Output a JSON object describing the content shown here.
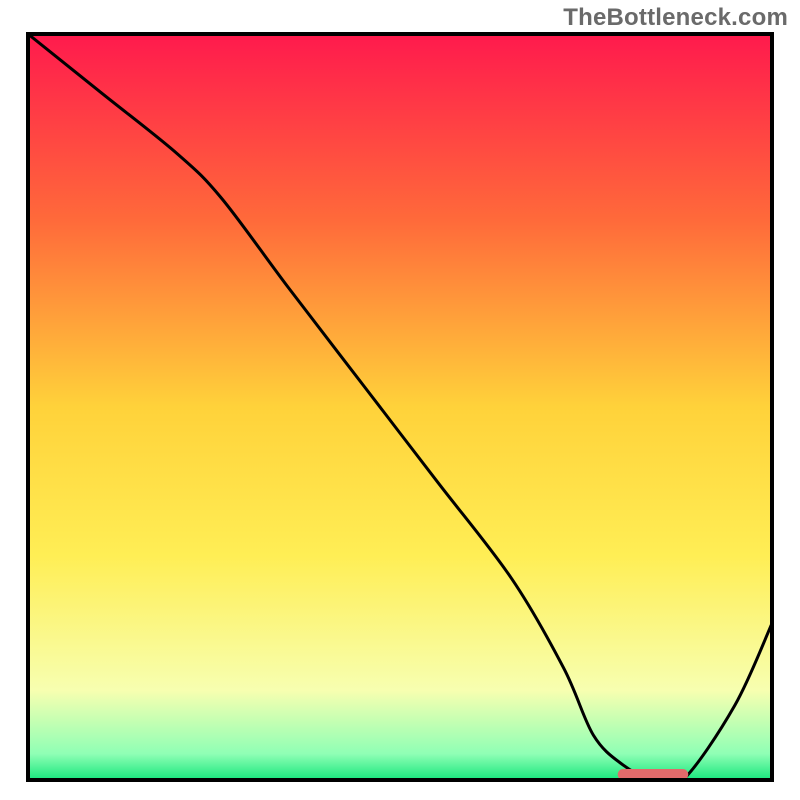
{
  "watermark": "TheBottleneck.com",
  "chart_data": {
    "type": "line",
    "title": "",
    "xlabel": "",
    "ylabel": "",
    "xlim": [
      0,
      100
    ],
    "ylim": [
      0,
      100
    ],
    "grid": false,
    "legend": false,
    "background_gradient": {
      "direction": "vertical",
      "stops": [
        {
          "pos": 0.0,
          "color": "#ff1a4d"
        },
        {
          "pos": 0.25,
          "color": "#ff6a3a"
        },
        {
          "pos": 0.5,
          "color": "#ffd23a"
        },
        {
          "pos": 0.7,
          "color": "#ffee55"
        },
        {
          "pos": 0.88,
          "color": "#f7ffb0"
        },
        {
          "pos": 0.965,
          "color": "#8fffb5"
        },
        {
          "pos": 1.0,
          "color": "#17e67c"
        }
      ]
    },
    "series": [
      {
        "name": "bottleneck-curve",
        "color": "#000000",
        "x": [
          0,
          10,
          20,
          26,
          35,
          45,
          55,
          65,
          72,
          76,
          80,
          84,
          88,
          95,
          100
        ],
        "y": [
          100,
          92,
          84,
          78,
          66,
          53,
          40,
          27,
          15,
          6,
          2,
          0,
          0,
          10,
          21
        ]
      }
    ],
    "marker": {
      "name": "optimal-range-marker",
      "color": "#e06a6a",
      "x_start": 80,
      "x_end": 88,
      "y": 0,
      "thickness_px": 11
    },
    "border": {
      "color": "#000000",
      "width": 4
    }
  }
}
